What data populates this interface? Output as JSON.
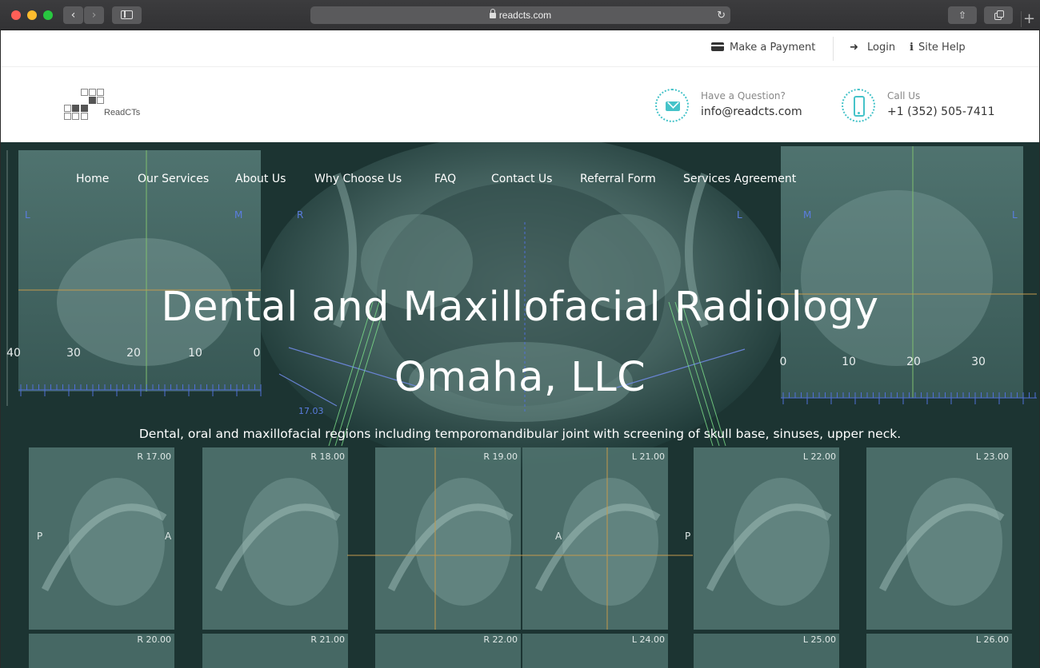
{
  "browser": {
    "url": "readcts.com"
  },
  "utility_bar": {
    "payment": "Make a Payment",
    "login": "Login",
    "help": "Site Help"
  },
  "header": {
    "logo_text": "ReadCTs",
    "email_label": "Have a Question?",
    "email_value": "info@readcts.com",
    "phone_label": "Call Us",
    "phone_value": "+1 (352) 505-7411"
  },
  "nav": {
    "items": [
      "Home",
      "Our Services",
      "About Us",
      "Why Choose Us",
      "FAQ",
      "Contact Us",
      "Referral Form",
      "Services Agreement"
    ]
  },
  "hero": {
    "title_line1": "Dental and Maxillofacial Radiology",
    "title_line2": "Omaha, LLC",
    "subtitle": "Dental, oral and maxillofacial regions including temporomandibular joint with screening of skull base, sinuses, upper neck.",
    "scan_labels_top": [
      "R 17.00",
      "R 18.00",
      "R 19.00",
      "L 21.00",
      "L 22.00",
      "L 23.00"
    ],
    "scan_labels_bottom": [
      "R 20.00",
      "R 21.00",
      "R 22.00",
      "L 24.00",
      "L 25.00",
      "L 26.00"
    ],
    "ruler_left": [
      "40",
      "30",
      "20",
      "10",
      "0"
    ],
    "ruler_right": [
      "0",
      "10",
      "20",
      "30"
    ],
    "measure": "17.03",
    "orientation": [
      "L",
      "M",
      "R",
      "L",
      "M",
      "L",
      "P",
      "A",
      "A",
      "P"
    ]
  }
}
